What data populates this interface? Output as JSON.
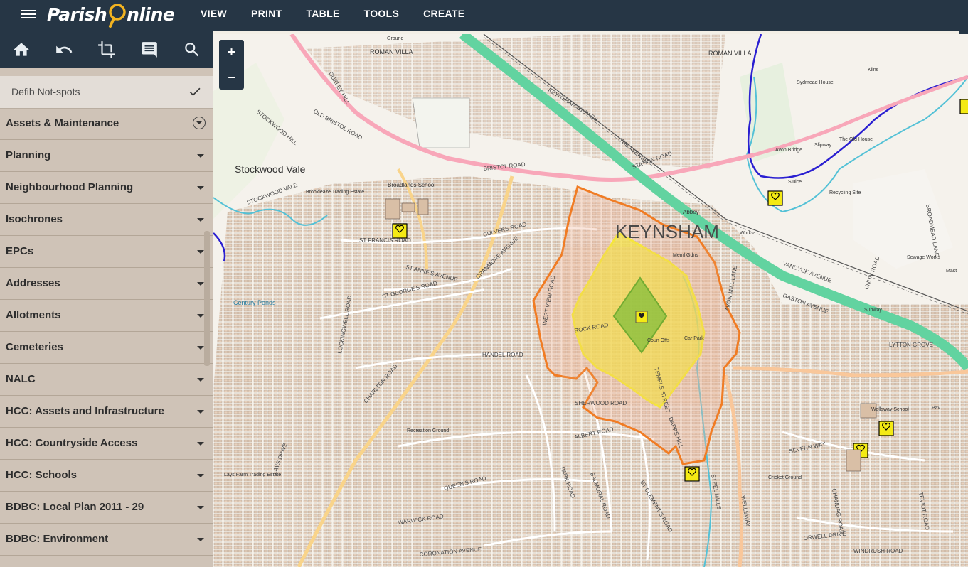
{
  "app": {
    "logo_part1": "Parish",
    "logo_part2": "nline"
  },
  "nav": [
    "VIEW",
    "PRINT",
    "TABLE",
    "TOOLS",
    "CREATE"
  ],
  "toolbar_icons": [
    "home-icon",
    "undo-icon",
    "crop-icon",
    "comment-icon",
    "search-icon"
  ],
  "sidebar": {
    "active_layer": {
      "label": "Defib Not-spots",
      "checked": true
    },
    "sections": [
      {
        "label": "Assets & Maintenance",
        "expanded": true
      },
      {
        "label": "Planning"
      },
      {
        "label": "Neighbourhood Planning"
      },
      {
        "label": "Isochrones"
      },
      {
        "label": "EPCs"
      },
      {
        "label": "Addresses"
      },
      {
        "label": "Allotments"
      },
      {
        "label": "Cemeteries"
      },
      {
        "label": "NALC"
      },
      {
        "label": "HCC: Assets and Infrastructure"
      },
      {
        "label": "HCC: Countryside Access"
      },
      {
        "label": "HCC: Schools"
      },
      {
        "label": "BDBC: Local Plan 2011 - 29"
      },
      {
        "label": "BDBC: Environment"
      }
    ]
  },
  "map": {
    "zoom_in": "+",
    "zoom_out": "−",
    "town": "KEYNSHAM",
    "places": [
      "Stockwood Vale",
      "ROMAN VILLA",
      "ROMAN VILLA",
      "Century Ponds",
      "Broadlands School",
      "Recycling Site",
      "Sewage Works",
      "Wellsway School",
      "Lays Farm Trading Estate",
      "Brookleaze Trading Estate",
      "Cricket Ground",
      "Recreation Ground",
      "Sydmead House",
      "The Old House",
      "Abbey",
      "Meml Gdns",
      "Kilns",
      "Avon Bridge",
      "Slipway",
      "Sluice",
      "Mast",
      "Subway",
      "Works",
      "Car Park",
      "Coun Offs",
      "Pav",
      "Ground"
    ],
    "roads": [
      "KEYNSHAM BY-PASS",
      "BRISTOL ROAD",
      "STATION ROAD",
      "CULVERS ROAD",
      "ST FRANCIS ROAD",
      "ST ANNE'S AVENUE",
      "ST GEORGE'S ROAD",
      "CRANMORE AVENUE",
      "HANDEL ROAD",
      "CHARLTON ROAD",
      "QUEEN'S ROAD",
      "WARWICK ROAD",
      "CORONATION AVENUE",
      "SHERWOOD ROAD",
      "ALBERT ROAD",
      "PARK ROAD",
      "BALMORAL ROAD",
      "ST CLEMENT'S ROAD",
      "DAPPS HILL",
      "STEEL MILLS",
      "WELLSWAY",
      "CHANDAG ROAD",
      "SEVERN WAY",
      "ORWELL DRIVE",
      "WINDRUSH ROAD",
      "TEVIOT ROAD",
      "GASTON AVENUE",
      "VANDYCK AVENUE",
      "LYTTON GROVE",
      "UNITY ROAD",
      "BROADMEAD LANE",
      "ROCK ROAD",
      "WEST VIEW ROAD",
      "THE AVENUE",
      "STOCKWOOD HILL",
      "DURLEY HILL",
      "OLD BRISTOL ROAD",
      "STOCKWOOD VALE",
      "LOCKINGWELL ROAD",
      "LAYS DRIVE",
      "TEMPLE STREET",
      "AVON MILL LANE"
    ],
    "layers": {
      "isochrone_10min": "#f07c24",
      "isochrone_5min": "#f5e63b",
      "isochrone_2min": "#72c02c",
      "defib_marker": "#f4ea14",
      "bypass_road": "#62d3a0",
      "a_road": "#f8a7b9",
      "boundary": "#2a1fd1",
      "river": "#53c1d6"
    }
  }
}
